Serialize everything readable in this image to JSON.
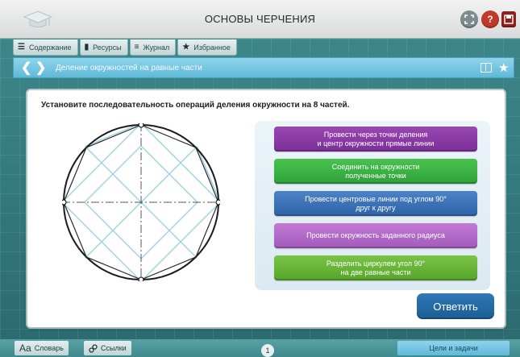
{
  "app": {
    "title": "ОСНОВЫ ЧЕРЧЕНИЯ"
  },
  "toolbar": {
    "fullscreen_icon": "fullscreen-icon",
    "help_label": "?",
    "save_icon": "save-icon"
  },
  "tabs": [
    {
      "icon": "☰",
      "label": "Содержание"
    },
    {
      "icon": "▮",
      "label": "Ресурсы"
    },
    {
      "icon": "≡",
      "label": "Журнал"
    },
    {
      "icon": "★",
      "label": "Избранное"
    }
  ],
  "nav": {
    "breadcrumb": "Деление окружностей на равные части"
  },
  "task": {
    "question": "Установите последовательность операций деления окружности на 8 частей.",
    "options": [
      [
        "Провести через точки деления",
        "и центр окружности прямые линии"
      ],
      [
        "Соединить на окружности",
        "полученные точки"
      ],
      [
        "Провести центровые линии под углом 90°",
        "друг к другу"
      ],
      [
        "Провести окружность заданного радиуса",
        ""
      ],
      [
        "Разделить циркулем угол 90°",
        "на две равные части"
      ]
    ],
    "answer_label": "Ответить"
  },
  "bottom": {
    "glossary_prefix": "Aa",
    "glossary_label": "Словарь",
    "links_label": "Ссылки",
    "page_number": "1",
    "goals_label": "Цели и задачи"
  },
  "colors": {
    "background": "#3f8a8e",
    "nav_bar": "#5fb9d9",
    "answer_button": "#1c5d94",
    "drawing_lines": "#9fd3e3"
  }
}
